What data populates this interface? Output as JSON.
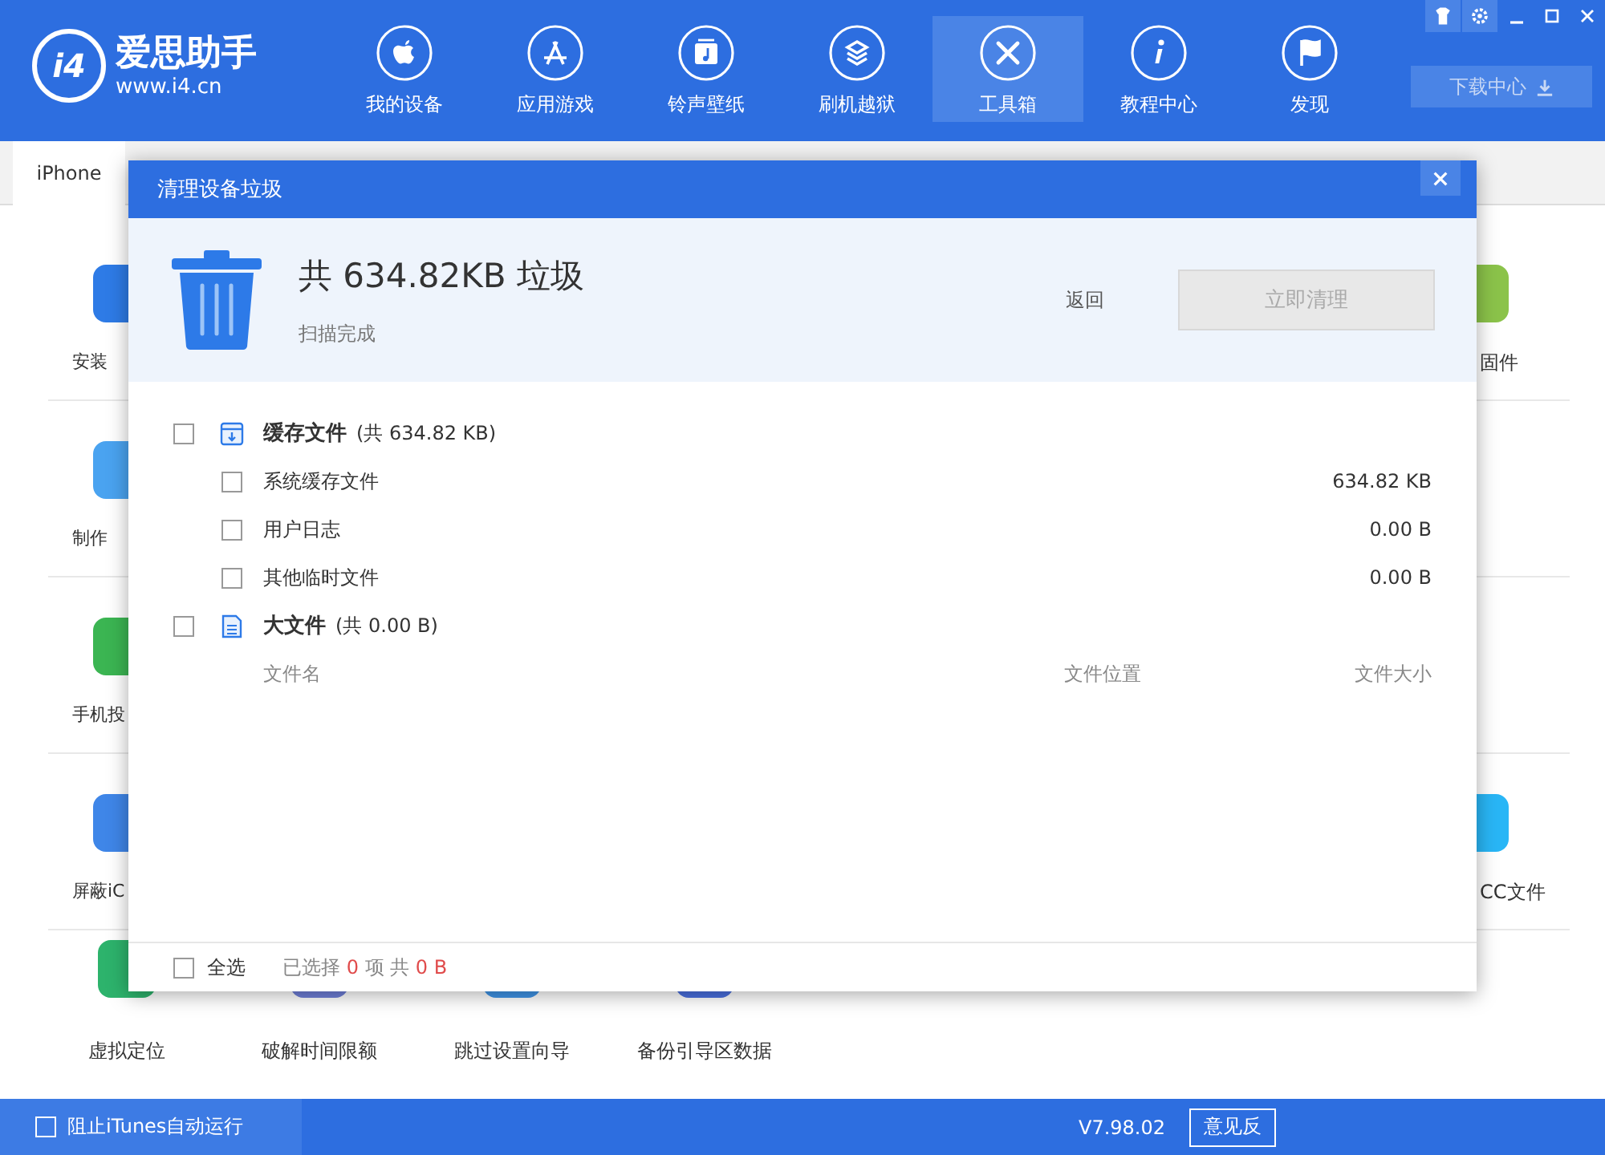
{
  "app": {
    "logo_mark": "i4",
    "logo_name": "爱思助手",
    "logo_url": "www.i4.cn"
  },
  "nav": [
    {
      "label": "我的设备",
      "selected": false
    },
    {
      "label": "应用游戏",
      "selected": false
    },
    {
      "label": "铃声壁纸",
      "selected": false
    },
    {
      "label": "刷机越狱",
      "selected": false
    },
    {
      "label": "工具箱",
      "selected": true
    },
    {
      "label": "教程中心",
      "selected": false
    },
    {
      "label": "发现",
      "selected": false
    }
  ],
  "download_button": "下载中心",
  "device_tabs": [
    {
      "label": "iPhone",
      "selected": true
    }
  ],
  "tools_left": [
    "安装",
    "制作",
    "手机投",
    "屏蔽iC"
  ],
  "tools_right": [
    "固件",
    "CC文件"
  ],
  "tools_bottom": [
    "虚拟定位",
    "破解时间限额",
    "跳过设置向导",
    "备份引导区数据"
  ],
  "dialog": {
    "title": "清理设备垃圾",
    "summary": "共 634.82KB 垃圾",
    "status": "扫描完成",
    "back": "返回",
    "clean_button": {
      "label": "立即清理",
      "disabled": true
    },
    "groups": [
      {
        "kind": "cache",
        "name": "缓存文件",
        "total": "(共 634.82 KB)",
        "checked": false,
        "items": [
          {
            "name": "系统缓存文件",
            "size": "634.82 KB",
            "checked": false
          },
          {
            "name": "用户日志",
            "size": "0.00 B",
            "checked": false
          },
          {
            "name": "其他临时文件",
            "size": "0.00 B",
            "checked": false
          }
        ]
      },
      {
        "kind": "document",
        "name": "大文件",
        "total": "(共 0.00 B)",
        "checked": false,
        "columns": [
          "文件名",
          "文件位置",
          "文件大小"
        ]
      }
    ],
    "footer": {
      "select_all": {
        "label": "全选",
        "checked": false
      },
      "selected_prefix": "已选择",
      "selected_count": "0",
      "unit": "项",
      "total_prefix": "共",
      "total": "0 B"
    }
  },
  "status_bar": {
    "itunes": {
      "label": "阻止iTunes自动运行",
      "checked": false
    },
    "version": "V7.98.02",
    "feedback": "意见反"
  }
}
